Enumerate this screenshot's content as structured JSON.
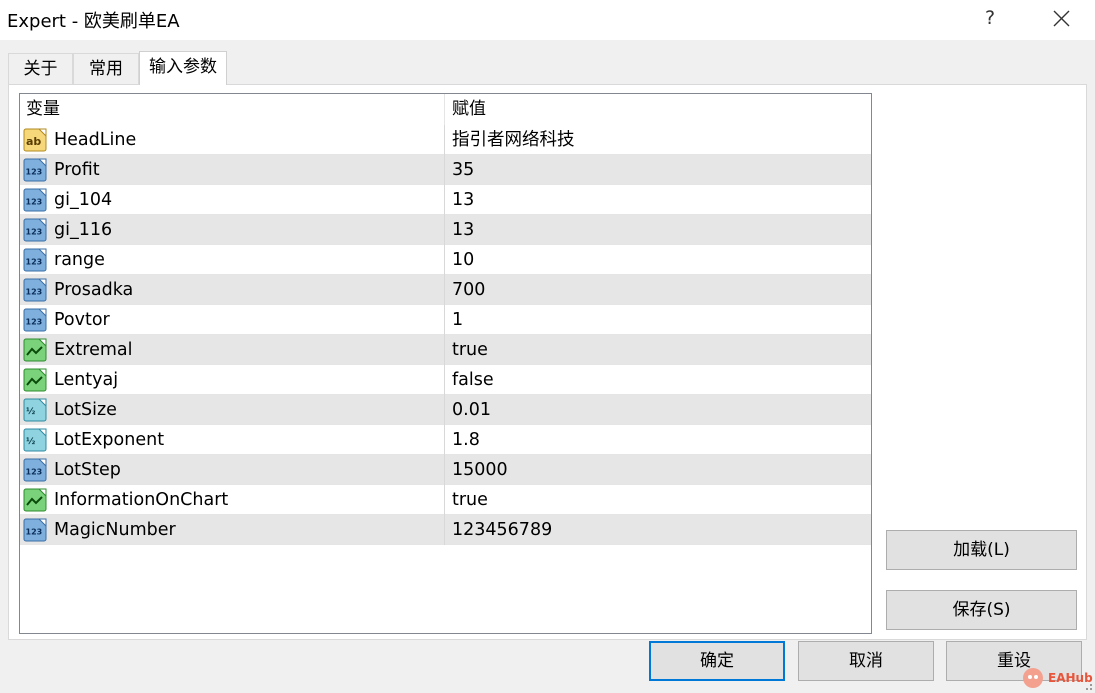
{
  "window": {
    "title": "Expert - 欧美刷单EA",
    "help_label": "?"
  },
  "tabs": [
    {
      "label": "关于"
    },
    {
      "label": "常用"
    },
    {
      "label": "输入参数",
      "active": true
    }
  ],
  "grid": {
    "col_variable": "变量",
    "col_value": "赋值",
    "rows": [
      {
        "icon": "string-ab-icon",
        "name": "HeadLine",
        "value": "指引者网络科技"
      },
      {
        "icon": "integer-123-icon",
        "name": "Profit",
        "value": "35"
      },
      {
        "icon": "integer-123-icon",
        "name": "gi_104",
        "value": "13"
      },
      {
        "icon": "integer-123-icon",
        "name": "gi_116",
        "value": "13"
      },
      {
        "icon": "integer-123-icon",
        "name": "range",
        "value": "10"
      },
      {
        "icon": "integer-123-icon",
        "name": "Prosadka",
        "value": "700"
      },
      {
        "icon": "integer-123-icon",
        "name": "Povtor",
        "value": "1"
      },
      {
        "icon": "boolean-icon",
        "name": "Extremal",
        "value": "true"
      },
      {
        "icon": "boolean-icon",
        "name": "Lentyaj",
        "value": "false"
      },
      {
        "icon": "double-fraction-icon",
        "name": "LotSize",
        "value": "0.01"
      },
      {
        "icon": "double-fraction-icon",
        "name": "LotExponent",
        "value": "1.8"
      },
      {
        "icon": "integer-123-icon",
        "name": "LotStep",
        "value": "15000"
      },
      {
        "icon": "boolean-icon",
        "name": "InformationOnChart",
        "value": "true"
      },
      {
        "icon": "integer-123-icon",
        "name": "MagicNumber",
        "value": "123456789"
      }
    ]
  },
  "side_buttons": {
    "load_label": "加载(L)",
    "save_label": "保存(S)"
  },
  "bottom_buttons": {
    "ok_label": "确定",
    "cancel_label": "取消",
    "reset_label": "重设"
  },
  "watermark": {
    "text": "EAHub"
  },
  "colors": {
    "accent": "#0078d7",
    "alt_row": "#e6e6e6",
    "window_bg": "#f0f0f0"
  }
}
